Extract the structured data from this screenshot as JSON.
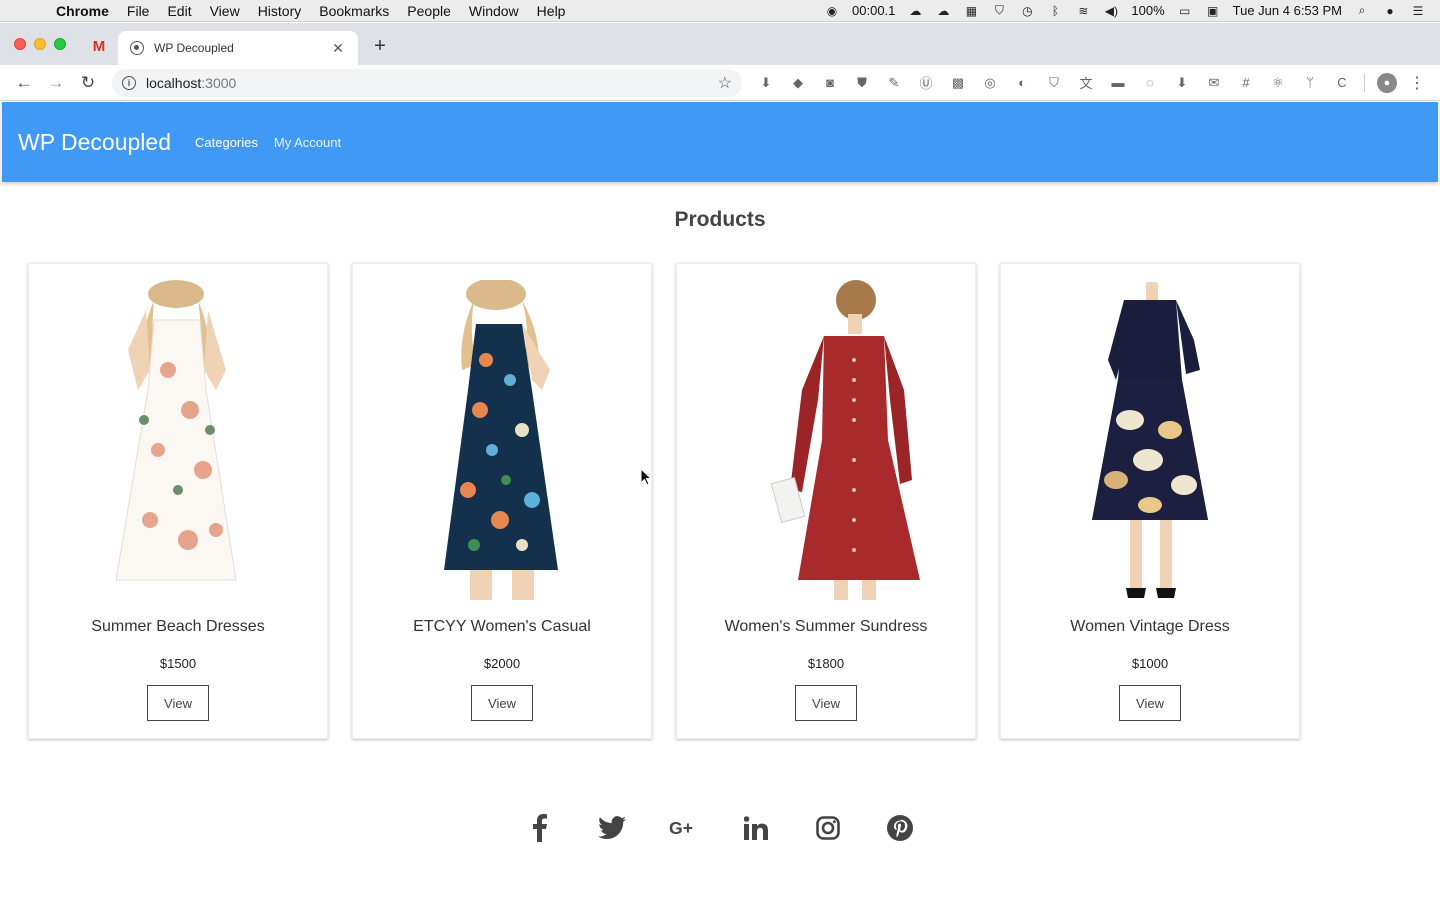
{
  "menubar": {
    "app_name": "Chrome",
    "items": [
      "File",
      "Edit",
      "View",
      "History",
      "Bookmarks",
      "People",
      "Window",
      "Help"
    ],
    "recording_time": "00:00.1",
    "battery": "100%",
    "datetime": "Tue Jun 4  6:53 PM"
  },
  "browser": {
    "tab_title": "WP Decoupled",
    "url_host": "localhost",
    "url_port": ":3000"
  },
  "site": {
    "brand": "WP Decoupled",
    "nav": [
      "Categories",
      "My Account"
    ],
    "heading": "Products",
    "products": [
      {
        "title": "Summer Beach Dresses",
        "price": "$1500",
        "button": "View"
      },
      {
        "title": "ETCYY Women's Casual",
        "price": "$2000",
        "button": "View"
      },
      {
        "title": "Women's Summer Sundress",
        "price": "$1800",
        "button": "View"
      },
      {
        "title": "Women Vintage Dress",
        "price": "$1000",
        "button": "View"
      }
    ],
    "social_icons": [
      "facebook-icon",
      "twitter-icon",
      "google-plus-icon",
      "linkedin-icon",
      "instagram-icon",
      "pinterest-icon"
    ]
  },
  "colors": {
    "appbar": "#3f99f5",
    "social": "#444444"
  }
}
